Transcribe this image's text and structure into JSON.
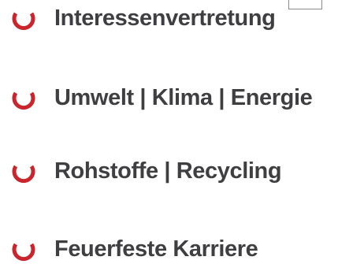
{
  "brand_color": "#c9252c",
  "text_color": "#3f3f42",
  "menu": {
    "items": [
      {
        "label": "Interessenvertretung",
        "icon": "arc-icon"
      },
      {
        "label": "Umwelt | Klima | Energie",
        "icon": "arc-icon"
      },
      {
        "label": "Rohstoffe | Recycling",
        "icon": "arc-icon"
      },
      {
        "label": "Feuerfeste Karriere",
        "icon": "arc-icon"
      }
    ]
  }
}
